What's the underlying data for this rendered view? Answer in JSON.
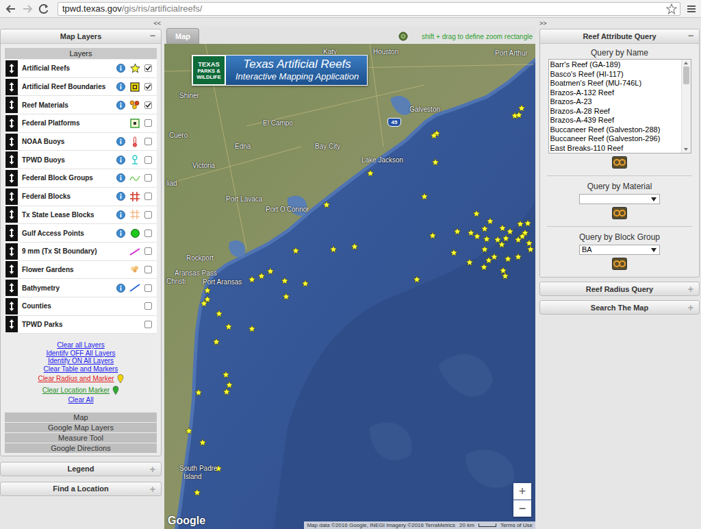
{
  "browser": {
    "url_host": "tpwd.texas.gov",
    "url_path": "/gis/ris/artificialreefs/"
  },
  "collapse_left": "<<",
  "collapse_right": ">>",
  "layers_panel": {
    "title": "Map Layers",
    "toggle": "−",
    "header": "Layers",
    "layers": [
      {
        "name": "Artificial Reefs",
        "info": true,
        "kind": "star",
        "checked": true
      },
      {
        "name": "Artificial Reef Boundaries",
        "info": true,
        "kind": "boundary",
        "checked": true
      },
      {
        "name": "Reef Materials",
        "info": true,
        "kind": "materials",
        "checked": true
      },
      {
        "name": "Federal Platforms",
        "info": false,
        "kind": "platform",
        "checked": false
      },
      {
        "name": "NOAA Buoys",
        "info": true,
        "kind": "noaa",
        "checked": false
      },
      {
        "name": "TPWD Buoys",
        "info": true,
        "kind": "buoy",
        "checked": false
      },
      {
        "name": "Federal Block Groups",
        "info": true,
        "kind": "groups",
        "checked": false
      },
      {
        "name": "Federal Blocks",
        "info": true,
        "kind": "blocks",
        "checked": false
      },
      {
        "name": "Tx State Lease Blocks",
        "info": true,
        "kind": "lease",
        "checked": false
      },
      {
        "name": "Gulf Access Points",
        "info": true,
        "kind": "access",
        "checked": false
      },
      {
        "name": "9 mm (Tx St Boundary)",
        "info": false,
        "kind": "line",
        "checked": false
      },
      {
        "name": "Flower Gardens",
        "info": false,
        "kind": "gardens",
        "checked": false
      },
      {
        "name": "Bathymetry",
        "info": true,
        "kind": "bathymetry",
        "checked": false
      },
      {
        "name": "Counties",
        "info": false,
        "kind": "none",
        "checked": false
      },
      {
        "name": "TPWD Parks",
        "info": false,
        "kind": "none",
        "checked": false
      }
    ]
  },
  "actions": [
    {
      "label": "Clear all Layers",
      "color": "#1a1aee",
      "marker_color": null
    },
    {
      "label": "Identify OFF All Layers",
      "color": "#1a1aee",
      "marker_color": null
    },
    {
      "label": "Identify ON All Layers",
      "color": "#1a1aee",
      "marker_color": null
    },
    {
      "label": "Clear Table and Markers",
      "color": "#1a1aee",
      "marker_color": null
    },
    {
      "label": "Clear Radius and Marker",
      "color": "#e02020",
      "marker_color": "#f2d20c"
    },
    {
      "label": "Clear Location Marker",
      "color": "#1f8f1f",
      "marker_color": "#2eaa2e"
    },
    {
      "label": "Clear All",
      "color": "#1a1aee",
      "marker_color": null
    }
  ],
  "sections": [
    "Map",
    "Google Map Layers",
    "Measure Tool",
    "Google Directions"
  ],
  "bottom_panels": [
    {
      "title": "Legend",
      "toggle": "+"
    },
    {
      "title": "Find a Location",
      "toggle": "+"
    }
  ],
  "map": {
    "tab": "Map",
    "hint": "shift + drag to define zoom rectangle",
    "logo": [
      "TEXAS",
      "PARKS &",
      "WILDLIFE"
    ],
    "title": "Texas Artificial Reefs",
    "subtitle": "Interactive Mapping Application",
    "places": [
      "Katy",
      "Houston",
      "Port Arthur",
      "Shiner",
      "Galveston",
      "El Campo",
      "Cuero",
      "Edna",
      "Bay City",
      "Lake Jackson",
      "Victoria",
      "liad",
      "Port Lavaca",
      "Port O'Connor",
      "Rockport",
      "Aransas Pass",
      "Christi",
      "Port Aransas",
      "South Padre",
      "Island"
    ],
    "highways": [
      "45"
    ],
    "google": "Google",
    "attribution": "Map data ©2016 Google, INEGI Imagery ©2016 TerraMetrics",
    "scale": "20 km",
    "terms": "Terms of Use",
    "zoom_in": "+",
    "zoom_out": "−"
  },
  "query_panel": {
    "title": "Reef Attribute Query",
    "toggle": "−",
    "by_name": {
      "label": "Query by Name",
      "items": [
        {
          "label": "Barr's Reef (GA-189)",
          "selected": false
        },
        {
          "label": "Basco's Reef (HI-117)",
          "selected": false
        },
        {
          "label": "Boatmen's Reef (MU-746L)",
          "selected": false
        },
        {
          "label": "Brazos-A-132 Reef",
          "selected": false
        },
        {
          "label": "Brazos-A-23",
          "selected": false
        },
        {
          "label": "Brazos-A-28 Reef",
          "selected": false
        },
        {
          "label": "Brazos-A-439 Reef",
          "selected": false
        },
        {
          "label": "Buccaneer Reef (Galveston-288)",
          "selected": false
        },
        {
          "label": "Buccaneer Reef (Galveston-296)",
          "selected": false
        },
        {
          "label": "East Breaks-110 Reef",
          "selected": false
        }
      ]
    },
    "by_material": {
      "label": "Query by Material",
      "value": ""
    },
    "by_block_group": {
      "label": "Query by Block Group",
      "value": "BA"
    }
  },
  "extra_panels": [
    {
      "title": "Reef Radius Query",
      "toggle": "+"
    },
    {
      "title": "Search The Map",
      "toggle": "+"
    }
  ]
}
